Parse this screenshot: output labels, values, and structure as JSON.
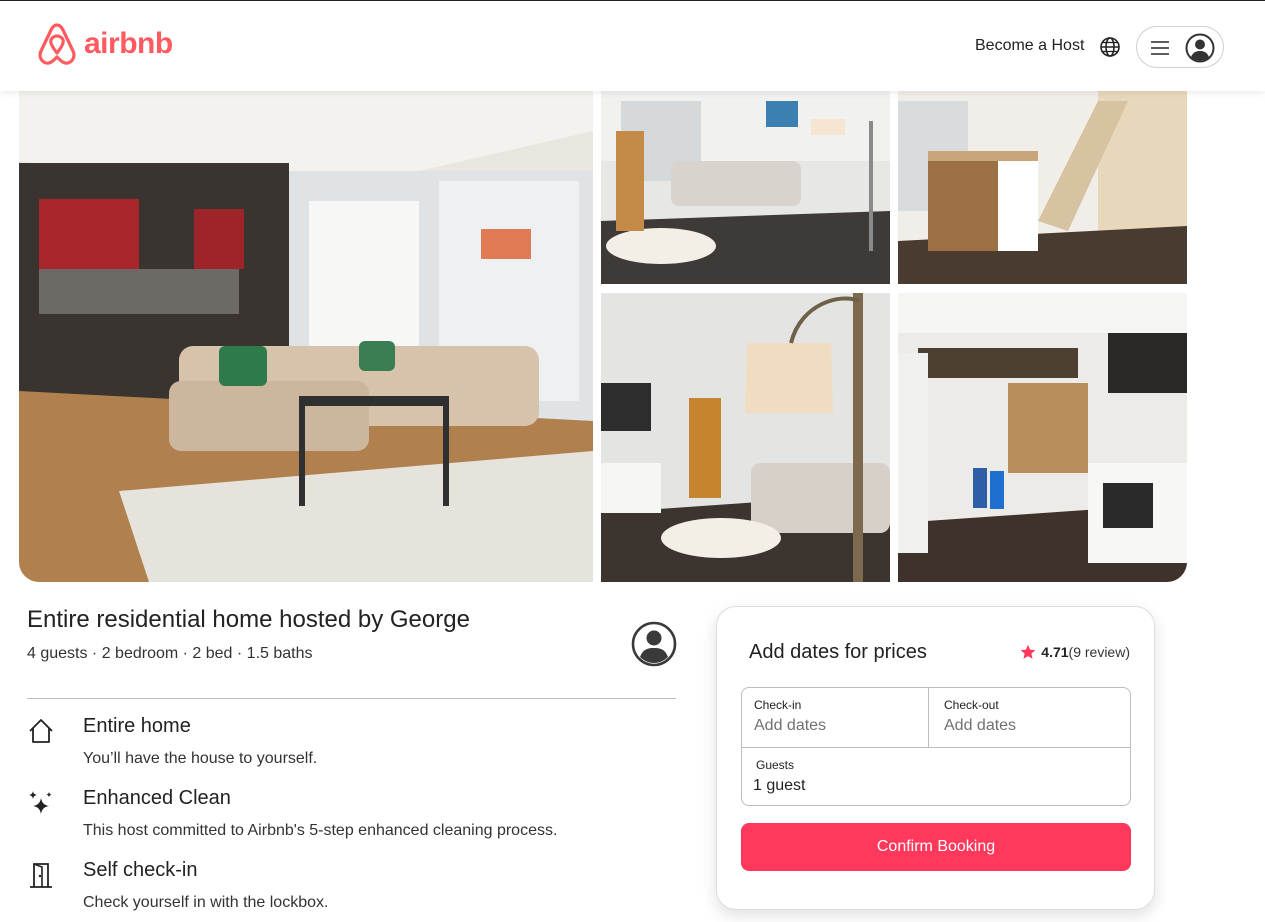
{
  "brand": {
    "name": "airbnb",
    "color": "#ff5a5f"
  },
  "header": {
    "become_host": "Become a Host",
    "globe_icon": "globe-icon",
    "menu_icon": "hamburger-icon",
    "avatar_icon": "user-avatar-icon"
  },
  "gallery": {
    "photos": [
      {
        "name": "living-room-main",
        "alt": "Living room with sectional sofa and kitchen"
      },
      {
        "name": "living-room-easel",
        "alt": "Living room with easel and floor lamp"
      },
      {
        "name": "kitchen-stairs",
        "alt": "Kitchen island and staircase"
      },
      {
        "name": "lamp-living-room",
        "alt": "Floor lamp and living room"
      },
      {
        "name": "kitchen-hallway",
        "alt": "Kitchen hallway with fireplace"
      }
    ]
  },
  "listing": {
    "title": "Entire residential home hosted by George",
    "details": "4 guests · 2 bedroom · 2 bed · 1.5 baths",
    "features": [
      {
        "icon": "home-icon",
        "name": "Entire home",
        "description": "You’ll have the house to yourself."
      },
      {
        "icon": "sparkles-icon",
        "name": "Enhanced Clean",
        "description": "This host committed to Airbnb's 5-step enhanced cleaning process."
      },
      {
        "icon": "door-icon",
        "name": "Self check-in",
        "description": "Check yourself in with the lockbox."
      }
    ]
  },
  "booking": {
    "title": "Add dates for prices",
    "rating": "4.71",
    "reviews": "(9 review)",
    "checkin_label": "Check-in",
    "checkin_value": "Add dates",
    "checkout_label": "Check-out",
    "checkout_value": "Add dates",
    "guests_label": "Guests",
    "guests_value": "1 guest",
    "confirm_label": "Confirm Booking",
    "accent": "#ff385c"
  }
}
